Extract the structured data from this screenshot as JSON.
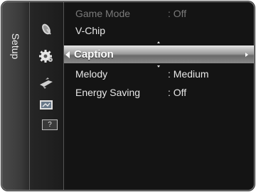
{
  "side_tab": {
    "label": "Setup"
  },
  "help_icon": {
    "label": "?"
  },
  "icons": [
    "satellite-dish-icon",
    "gear-icon",
    "remote-control-icon",
    "input-screen-icon",
    "help-icon"
  ],
  "menu": {
    "items": [
      {
        "name": "Game Mode",
        "value": ": Off",
        "state": "dim"
      },
      {
        "name": "V-Chip",
        "value": "",
        "state": "normal"
      },
      {
        "name": "Caption",
        "value": "",
        "state": "selected"
      },
      {
        "name": "Melody",
        "value": ": Medium",
        "state": "normal"
      },
      {
        "name": "Energy Saving",
        "value": ": Off",
        "state": "normal"
      }
    ]
  },
  "colors": {
    "background": "#141414",
    "selection": "#9a9a9a",
    "dim_text": "#7a7a7a"
  }
}
